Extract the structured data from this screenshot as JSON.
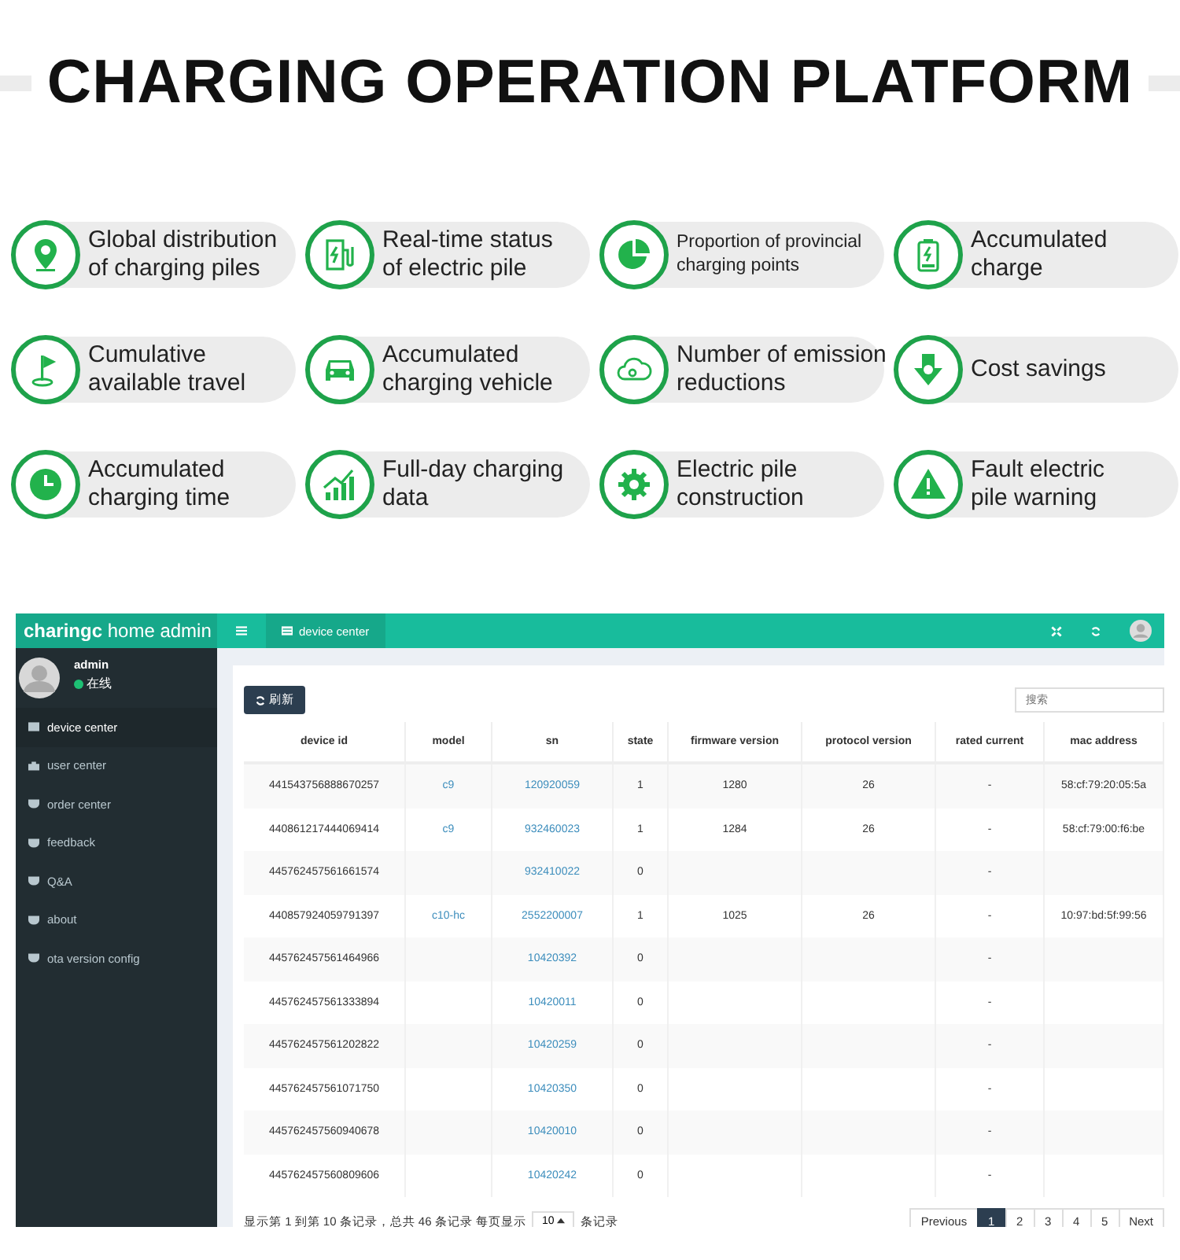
{
  "title": "CHARGING OPERATION PLATFORM",
  "features": [
    {
      "lines": [
        "Global distribution",
        "of charging piles"
      ],
      "compact": false
    },
    {
      "lines": [
        "Real-time status",
        "of electric pile"
      ],
      "compact": false
    },
    {
      "lines": [
        "Proportion of provincial",
        "charging points"
      ],
      "compact": true
    },
    {
      "lines": [
        "Accumulated",
        "charge"
      ],
      "compact": false
    },
    {
      "lines": [
        "Cumulative",
        "available travel"
      ],
      "compact": false
    },
    {
      "lines": [
        "Accumulated",
        "charging vehicle"
      ],
      "compact": false
    },
    {
      "lines": [
        "Number of emission",
        "reductions"
      ],
      "compact": false
    },
    {
      "lines": [
        "Cost savings"
      ],
      "compact": false
    },
    {
      "lines": [
        "Accumulated",
        "charging time"
      ],
      "compact": false
    },
    {
      "lines": [
        "Full-day charging",
        "data"
      ],
      "compact": false
    },
    {
      "lines": [
        "Electric pile",
        "construction"
      ],
      "compact": false
    },
    {
      "lines": [
        "Fault electric",
        "pile warning"
      ],
      "compact": false
    }
  ],
  "admin": {
    "logo": "**charingc** home admin",
    "tab": "device center",
    "user": {
      "name": "admin",
      "status": "在线",
      "online": true
    },
    "sidebar": [
      {
        "label": "device center",
        "selected": true
      },
      {
        "label": "user center",
        "selected": false
      },
      {
        "label": "order center",
        "selected": false
      },
      {
        "label": "feedback",
        "selected": false
      },
      {
        "label": "Q&A",
        "selected": false
      },
      {
        "label": "about",
        "selected": false
      },
      {
        "label": "ota version config",
        "selected": false
      }
    ],
    "refresh_button": "刷新",
    "search": {
      "placeholder": "搜索"
    },
    "table": {
      "columns": [
        "device id",
        "model",
        "sn",
        "state",
        "firmware version",
        "protocol version",
        "rated current",
        "mac address"
      ],
      "rows": [
        [
          "441543756888670257",
          "c9",
          "120920059",
          "1",
          "1280",
          "26",
          "-",
          "58:cf:79:20:05:5a"
        ],
        [
          "440861217444069414",
          "c9",
          "932460023",
          "1",
          "1284",
          "26",
          "-",
          "58:cf:79:00:f6:be"
        ],
        [
          "445762457561661574",
          "",
          "932410022",
          "0",
          "",
          "",
          "-",
          ""
        ],
        [
          "440857924059791397",
          "c10-hc",
          "2552200007",
          "1",
          "1025",
          "26",
          "-",
          "10:97:bd:5f:99:56"
        ],
        [
          "445762457561464966",
          "",
          "10420392",
          "0",
          "",
          "",
          "-",
          ""
        ],
        [
          "445762457561333894",
          "",
          "10420011",
          "0",
          "",
          "",
          "-",
          ""
        ],
        [
          "445762457561202822",
          "",
          "10420259",
          "0",
          "",
          "",
          "-",
          ""
        ],
        [
          "445762457561071750",
          "",
          "10420350",
          "0",
          "",
          "",
          "-",
          ""
        ],
        [
          "445762457560940678",
          "",
          "10420010",
          "0",
          "",
          "",
          "-",
          ""
        ],
        [
          "445762457560809606",
          "",
          "10420242",
          "0",
          "",
          "",
          "-",
          ""
        ]
      ]
    },
    "footer": {
      "summary": "显示第 1 到第 10 条记录，总共 46 条记录 每页显示",
      "page_size": "10",
      "suffix": "条记录"
    },
    "pagination": [
      {
        "label": "Previous",
        "selected": false
      },
      {
        "label": "1",
        "selected": true
      },
      {
        "label": "2",
        "selected": false
      },
      {
        "label": "3",
        "selected": false
      },
      {
        "label": "4",
        "selected": false
      },
      {
        "label": "5",
        "selected": false
      },
      {
        "label": "Next",
        "selected": false
      }
    ]
  }
}
